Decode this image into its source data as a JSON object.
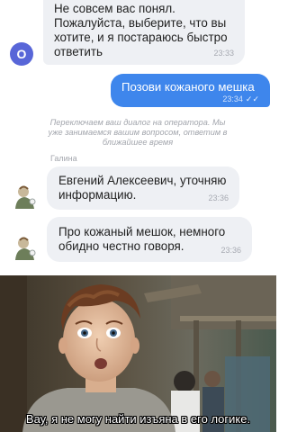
{
  "chat": {
    "messages": [
      {
        "direction": "incoming",
        "avatar_letter": "O",
        "line1": "Не совсем вас понял.",
        "line2": "Пожалуйста, выберите, что вы",
        "line3": "хотите, и я постараюсь быстро",
        "line4": "ответить",
        "time": "23:33"
      },
      {
        "direction": "outgoing",
        "text": "Позови кожаного мешка",
        "time": "23:34",
        "status": "✓✓"
      },
      {
        "direction": "system",
        "line1": "Переключаем ваш диалог на оператора. Мы",
        "line2": "уже занимаемся вашим вопросом, ответим в",
        "line3": "ближайшее время"
      },
      {
        "direction": "incoming",
        "sender": "Галина",
        "line1": "Евгений Алексеевич, уточняю",
        "line2": "информацию.",
        "time": "23:36"
      },
      {
        "direction": "incoming",
        "line1": "Про кожаный мешок, немного",
        "line2": "обидно честно говоря.",
        "time": "23:36"
      }
    ]
  },
  "meme": {
    "caption": "Вау, я не могу найти изъяна в его логике."
  },
  "colors": {
    "incoming_bubble": "#eef0f4",
    "outgoing_bubble": "#3e86ec",
    "bot_avatar": "#5866d8"
  }
}
